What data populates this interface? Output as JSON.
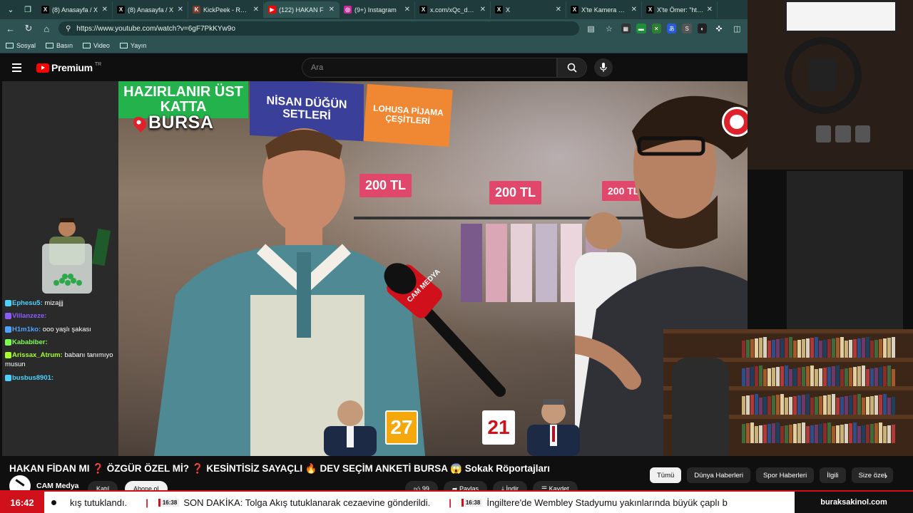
{
  "browser": {
    "tabs": [
      {
        "title": "(8) Anasayfa / X",
        "fav": "X",
        "fav_color": "#000000"
      },
      {
        "title": "(8) Anasayfa / X",
        "fav": "X",
        "fav_color": "#000000"
      },
      {
        "title": "KickPeek - Real-time",
        "fav": "K",
        "fav_color": "#7a3b2e"
      },
      {
        "title": "(122) HAKAN F",
        "fav": "▶",
        "fav_color": "#ff0000",
        "active": true
      },
      {
        "title": "(9+) Instagram",
        "fav": "◎",
        "fav_color": "#d6249f"
      },
      {
        "title": "x.com/xQc_dailyy/st",
        "fav": "X",
        "fav_color": "#000000"
      },
      {
        "title": "X",
        "fav": "X",
        "fav_color": "#000000"
      },
      {
        "title": "X'te Kamera Kaydı: (",
        "fav": "X",
        "fav_color": "#000000"
      },
      {
        "title": "X'te Ömer: \"https://",
        "fav": "X",
        "fav_color": "#000000"
      }
    ],
    "url": "https://www.youtube.com/watch?v=6gF7PkKYw9o",
    "bookmarks": [
      "Sosyal",
      "Basın",
      "Video",
      "Yayın"
    ]
  },
  "youtube": {
    "brand": "Premium",
    "region": "TR",
    "search_placeholder": "Ara",
    "video_title": "HAKAN FİDAN MI ❓ ÖZGÜR ÖZEL Mİ? ❓ KESİNTİSİZ SAYAÇLI 🔥 DEV SEÇİM ANKETİ BURSA 😱 Sokak Röportajları",
    "channel": "CAM Medya",
    "join_label": "Katıl",
    "subscribe_label": "Abone ol",
    "action_like": "99",
    "action_share": "Paylaş",
    "action_save": "Kaydet",
    "action_download": "İndir",
    "chips": [
      "Tümü",
      "Dünya Haberleri",
      "Spor Haberleri",
      "İlgili",
      "Size özel"
    ]
  },
  "video_overlay": {
    "location": "BURSA",
    "sign_green": "HAZIRLANIR ÜST KATTA",
    "sign_blue": "NİSAN DÜĞÜN SETLERİ",
    "sign_orange": "LOHUSA PİJAMA ÇEŞİTLERİ",
    "price_1": "200 TL",
    "price_2": "200 TL",
    "price_3": "200 TL",
    "poll_left": "27",
    "poll_right": "21",
    "mic_brand": "CAM MEDYA"
  },
  "chat": [
    {
      "user": "Ephesu5:",
      "msg": "mizajjj",
      "color": "#4fd1ff"
    },
    {
      "user": "Villanzeze:",
      "msg": "",
      "color": "#8a5cff"
    },
    {
      "user": "H1m1ko:",
      "msg": "ooo yaşlı şakası",
      "color": "#4fa3ff"
    },
    {
      "user": "Kababiber:",
      "msg": "",
      "color": "#7cff4f"
    },
    {
      "user": "Arissax_Atrum:",
      "msg": "babanı tanımıyo musun",
      "color": "#a4ff2d"
    },
    {
      "user": "busbus8901:",
      "msg": "",
      "color": "#4fd1ff"
    }
  ],
  "ticker": {
    "time": "16:42",
    "items": [
      {
        "time": "",
        "text": "kış tutuklandı."
      },
      {
        "time": "16:38",
        "text": "SON DAKİKA: Tolga Akış tutuklanarak cezaevine gönderildi."
      },
      {
        "time": "16:38",
        "text": "İngiltere'de Wembley Stadyumu yakınlarında büyük çaplı b"
      }
    ],
    "site": "buraksakinol.com"
  },
  "icons": {
    "reload": "reload-icon",
    "back": "back-icon",
    "forward": "forward-icon",
    "home": "home-icon",
    "search": "search-icon",
    "mic": "mic-icon",
    "menu": "menu-icon"
  }
}
